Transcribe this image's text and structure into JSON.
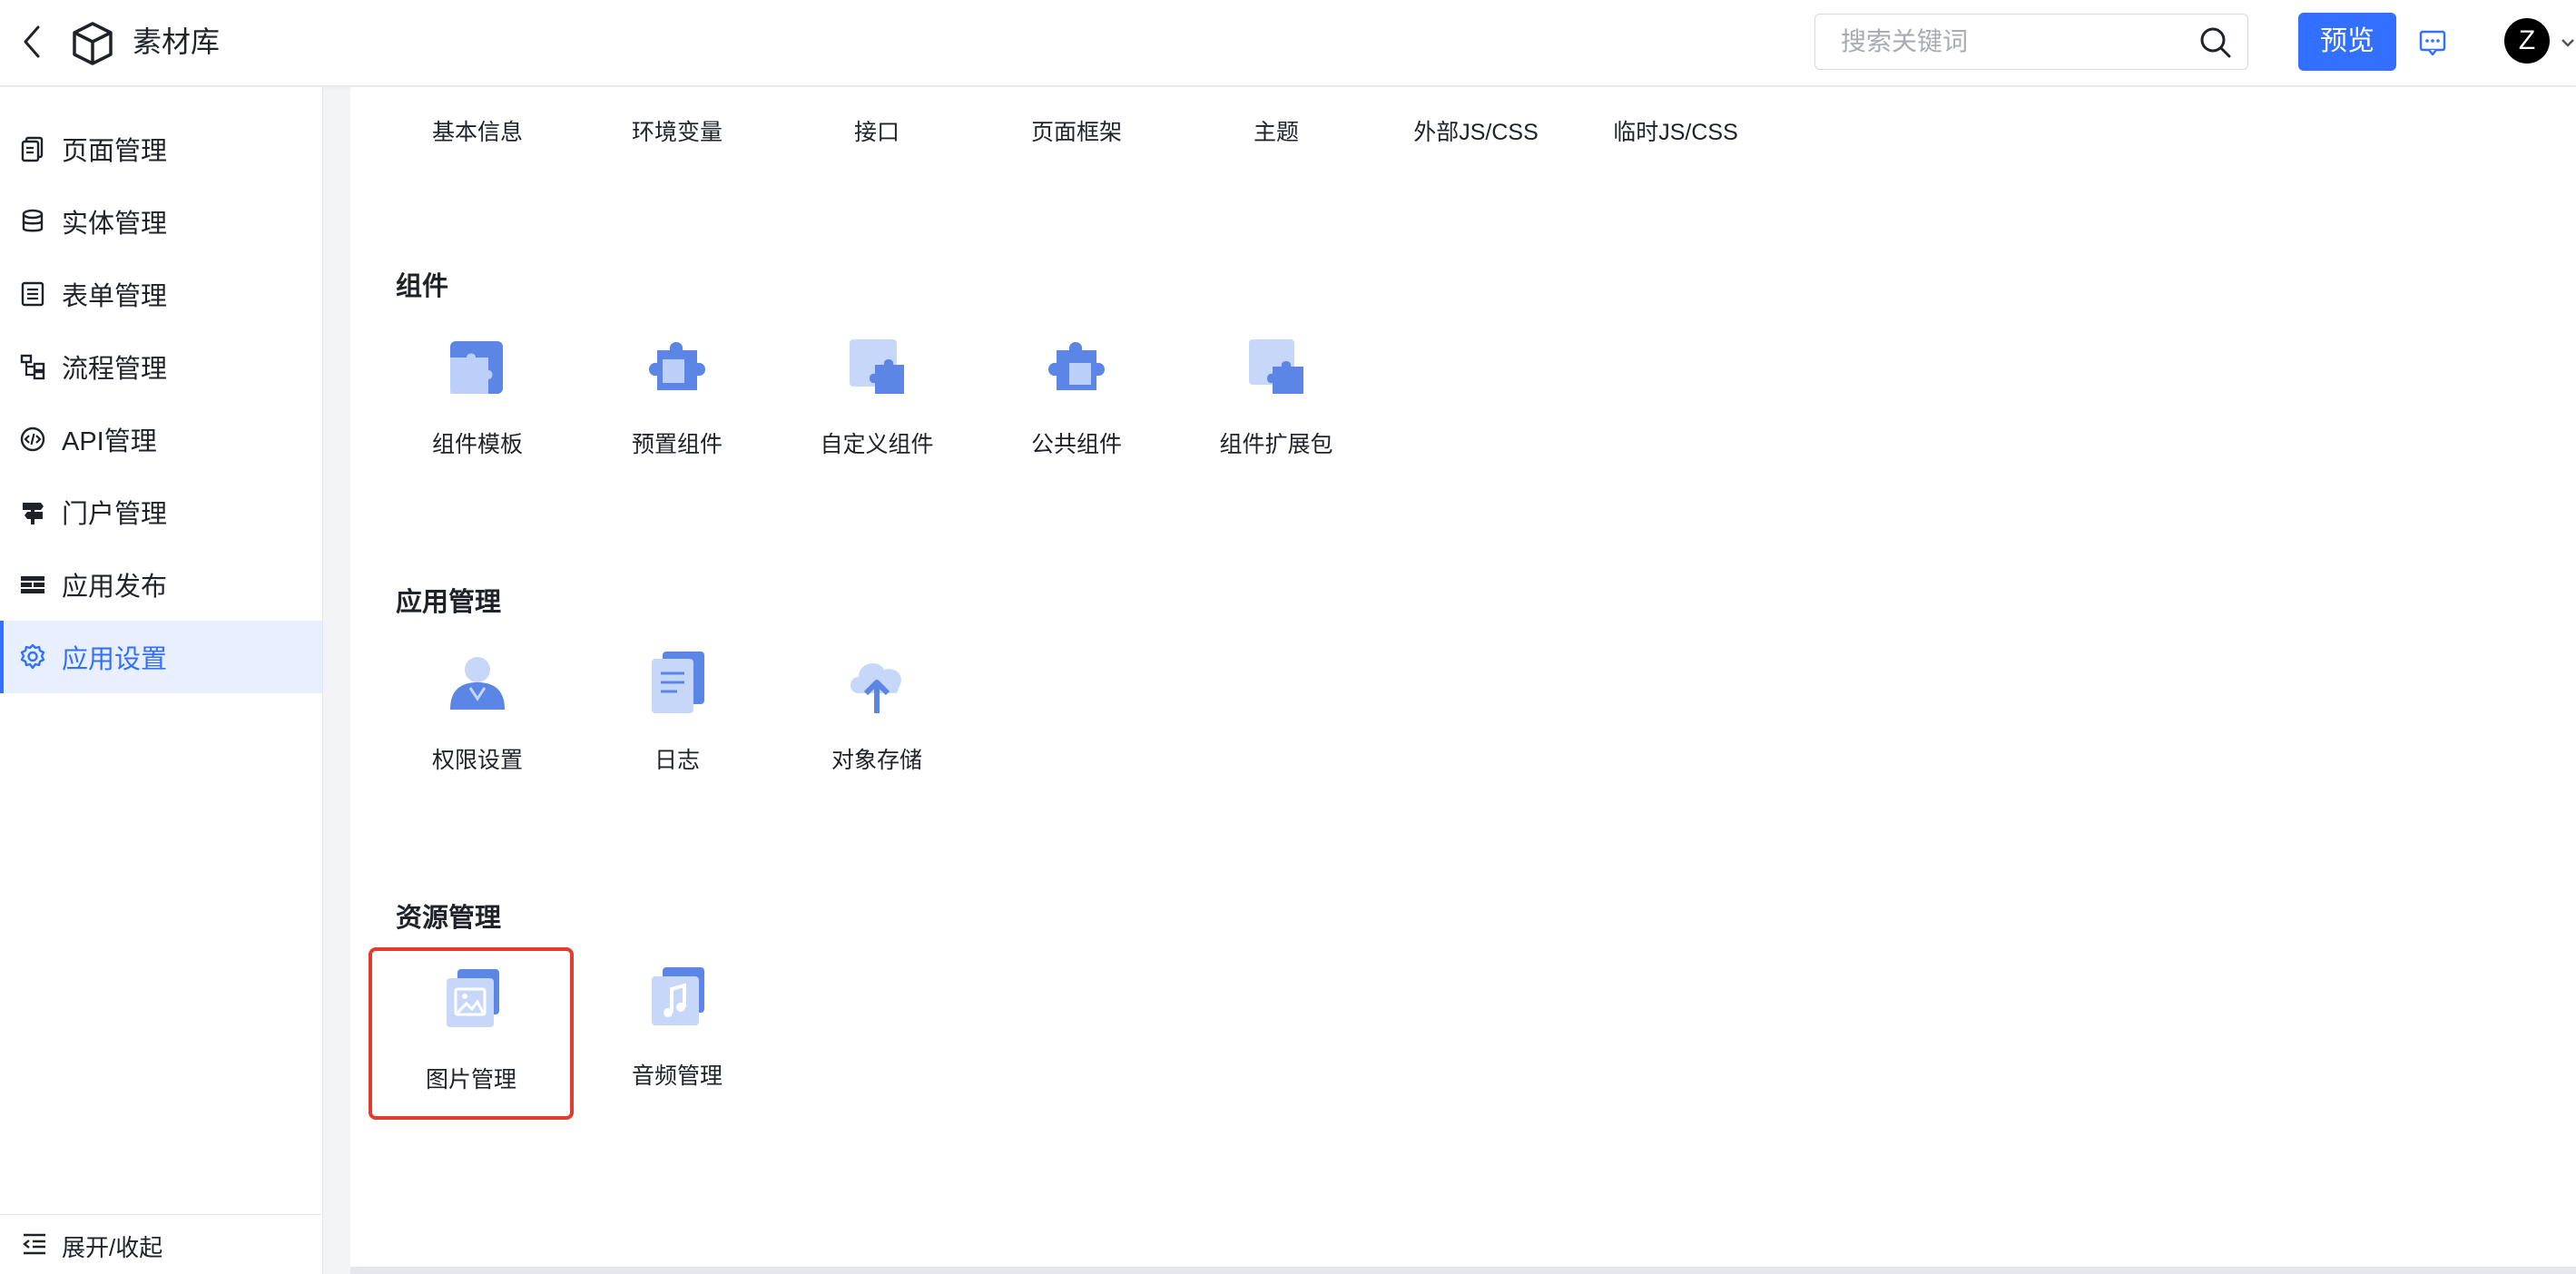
{
  "header": {
    "title": "素材库",
    "search_placeholder": "搜索关键词",
    "preview_label": "预览",
    "avatar_letter": "Z"
  },
  "sidebar": {
    "items": [
      {
        "label": "页面管理",
        "icon": "pages-icon"
      },
      {
        "label": "实体管理",
        "icon": "database-icon"
      },
      {
        "label": "表单管理",
        "icon": "form-icon"
      },
      {
        "label": "流程管理",
        "icon": "flow-icon"
      },
      {
        "label": "API管理",
        "icon": "api-icon"
      },
      {
        "label": "门户管理",
        "icon": "signpost-icon"
      },
      {
        "label": "应用发布",
        "icon": "publish-icon"
      },
      {
        "label": "应用设置",
        "icon": "gear-icon",
        "active": true
      }
    ],
    "footer_label": "展开/收起"
  },
  "main": {
    "top_links": [
      "基本信息",
      "环境变量",
      "接口",
      "页面框架",
      "主题",
      "外部JS/CSS",
      "临时JS/CSS"
    ],
    "sections": [
      {
        "title": "组件",
        "tiles": [
          "组件模板",
          "预置组件",
          "自定义组件",
          "公共组件",
          "组件扩展包"
        ]
      },
      {
        "title": "应用管理",
        "tiles": [
          "权限设置",
          "日志",
          "对象存储"
        ]
      },
      {
        "title": "资源管理",
        "tiles": [
          "图片管理",
          "音频管理"
        ]
      }
    ]
  },
  "colors": {
    "accent": "#3370ff",
    "highlight_border": "#e33b2e",
    "active_bg": "#e8effe"
  }
}
